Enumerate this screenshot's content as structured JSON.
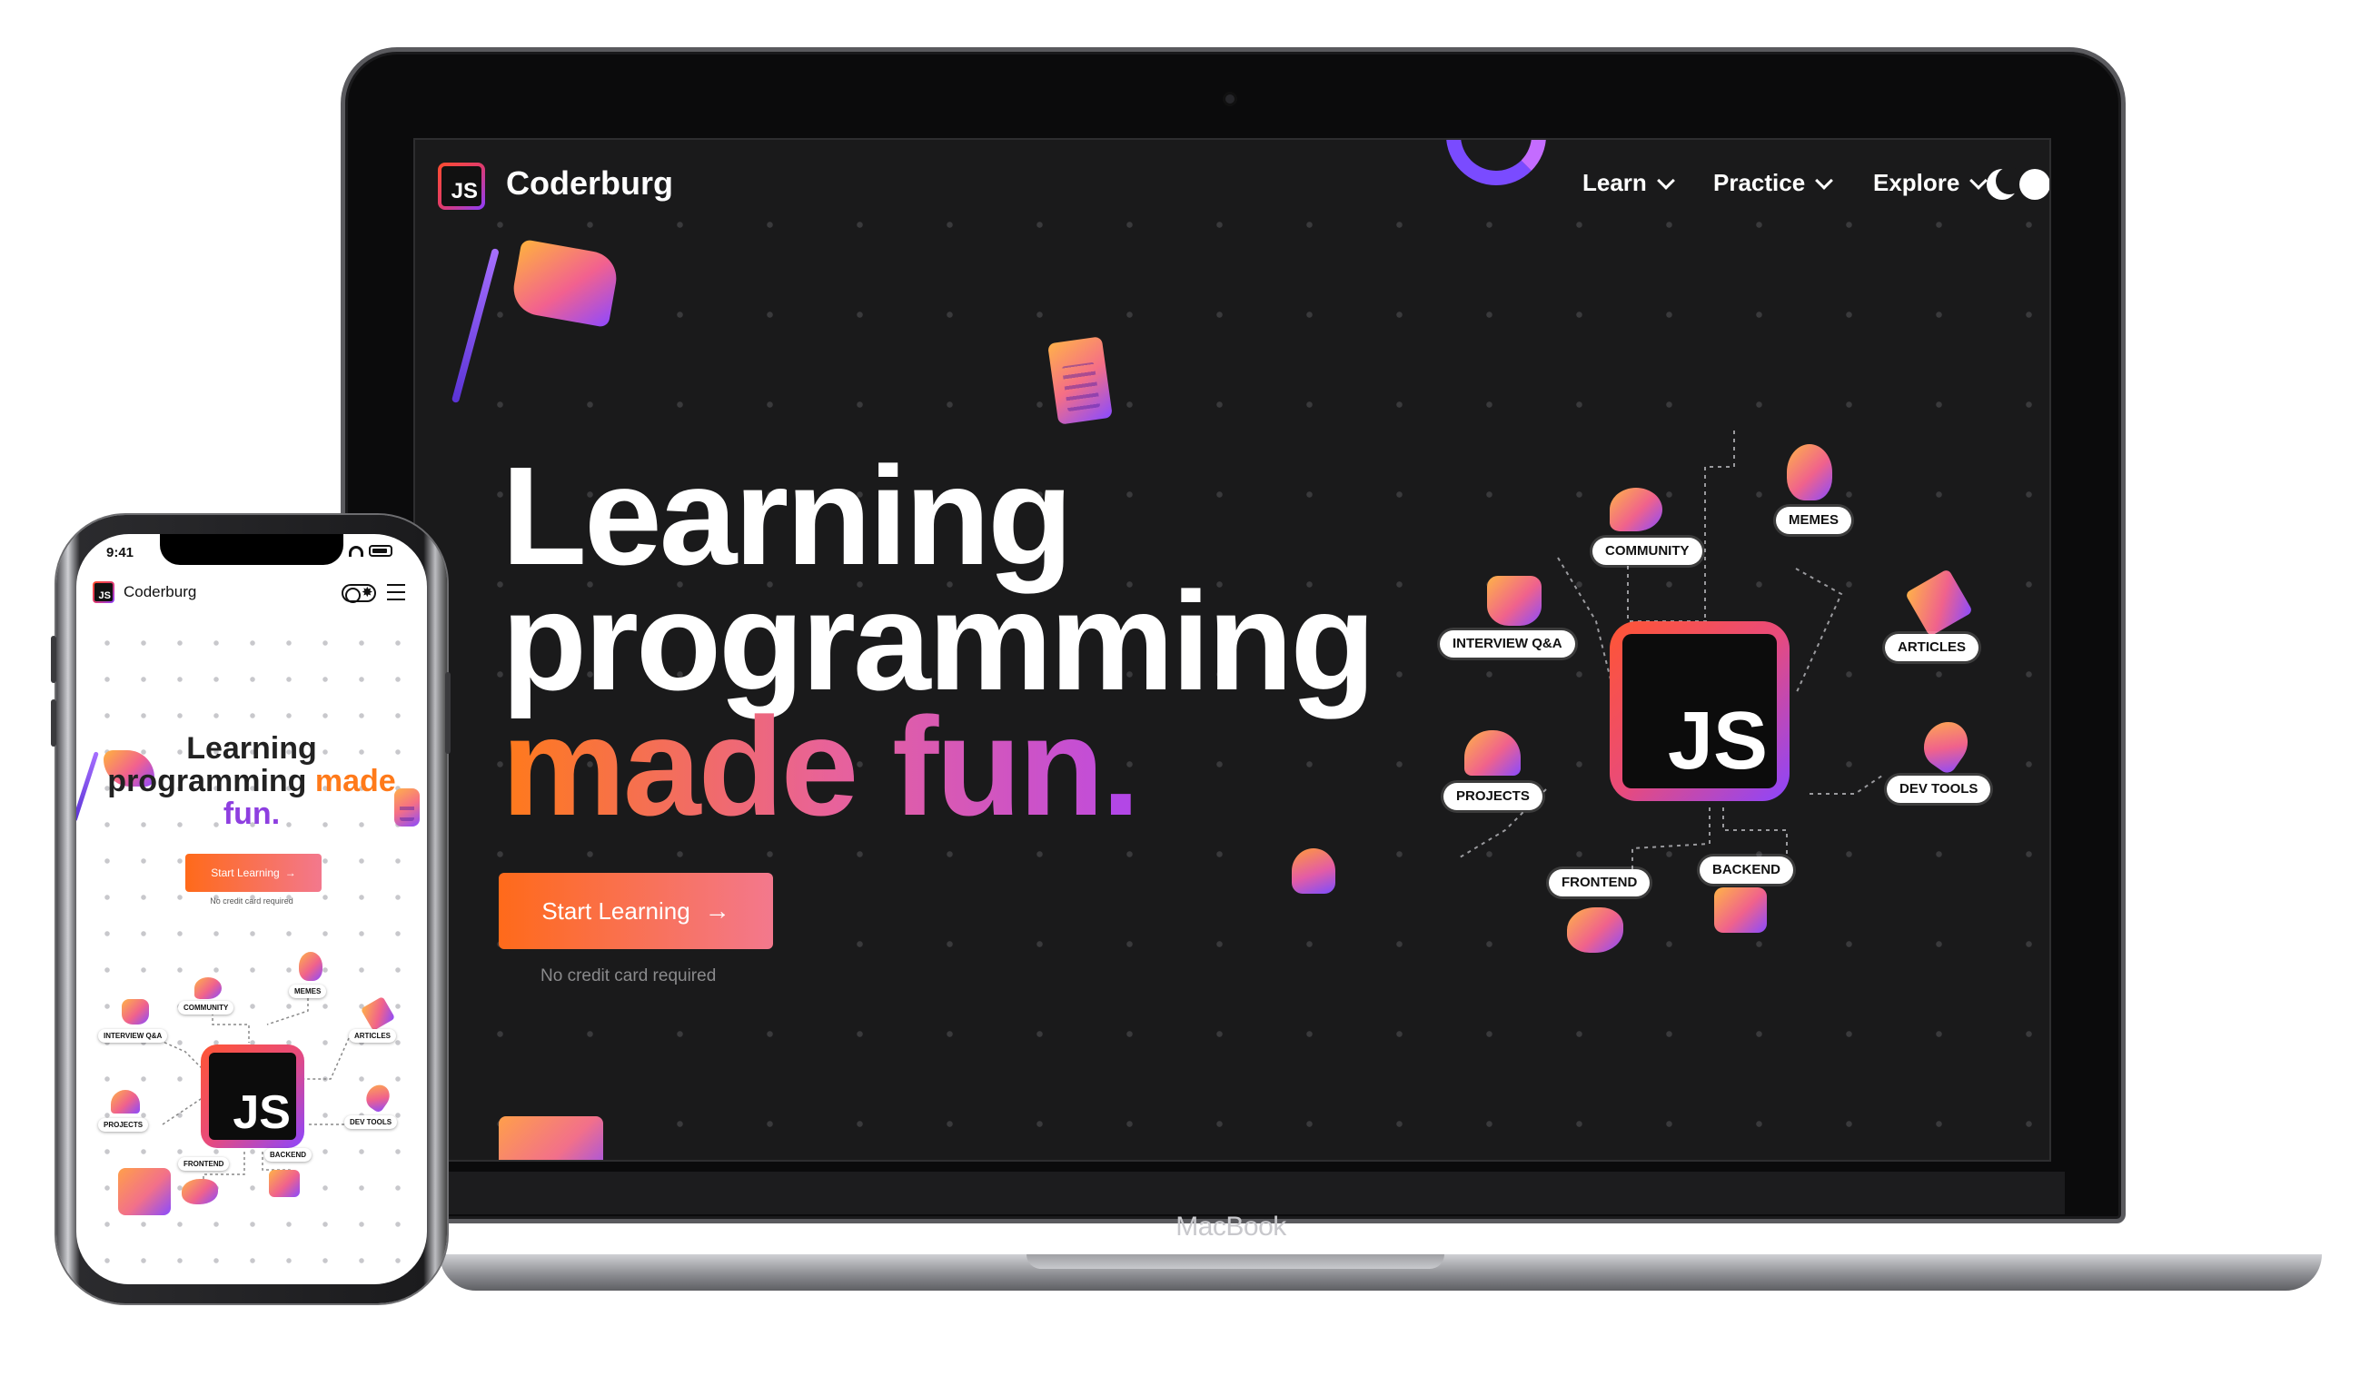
{
  "colors": {
    "brand_gradient": [
      "#ff4d2d",
      "#e13b6b",
      "#8a3cff"
    ],
    "cta_gradient": [
      "#ff6a1a",
      "#f3788d"
    ],
    "dark_bg": "#1a1a1b",
    "accent_orange": "#ff7a1a",
    "accent_purple": "#8e3fe0"
  },
  "laptop": {
    "device_brand": "MacBook",
    "nav": {
      "logo_text": "JS",
      "brand_name": "Coderburg",
      "items": [
        {
          "label": "Learn",
          "icon": "chevron-down-icon"
        },
        {
          "label": "Practice",
          "icon": "chevron-down-icon"
        },
        {
          "label": "Explore",
          "icon": "chevron-down-icon"
        }
      ],
      "theme_toggle_icons": [
        "moon-icon",
        "sun-icon"
      ]
    },
    "hero": {
      "title_line1": "Learning",
      "title_line2": "programming",
      "title_line3": "made fun",
      "title_dot": ".",
      "cta_label": "Start Learning",
      "cta_icon": "arrow-right-icon",
      "cta_note": "No credit card required"
    },
    "map": {
      "center_label": "JS",
      "nodes": [
        "COMMUNITY",
        "MEMES",
        "INTERVIEW Q&A",
        "ARTICLES",
        "PROJECTS",
        "DEV TOOLS",
        "FRONTEND",
        "BACKEND"
      ]
    }
  },
  "phone": {
    "status_time": "9:41",
    "logo_text": "JS",
    "brand_name": "Coderburg",
    "title_line1": "Learning",
    "title_line2": "programming",
    "title_made": "made",
    "title_fun": "fun.",
    "cta_label": "Start Learning",
    "cta_arrow": "→",
    "cta_note": "No credit card required",
    "map": {
      "center_label": "JS",
      "nodes": [
        "COMMUNITY",
        "MEMES",
        "INTERVIEW Q&A",
        "ARTICLES",
        "PROJECTS",
        "DEV TOOLS",
        "FRONTEND",
        "BACKEND"
      ]
    }
  }
}
